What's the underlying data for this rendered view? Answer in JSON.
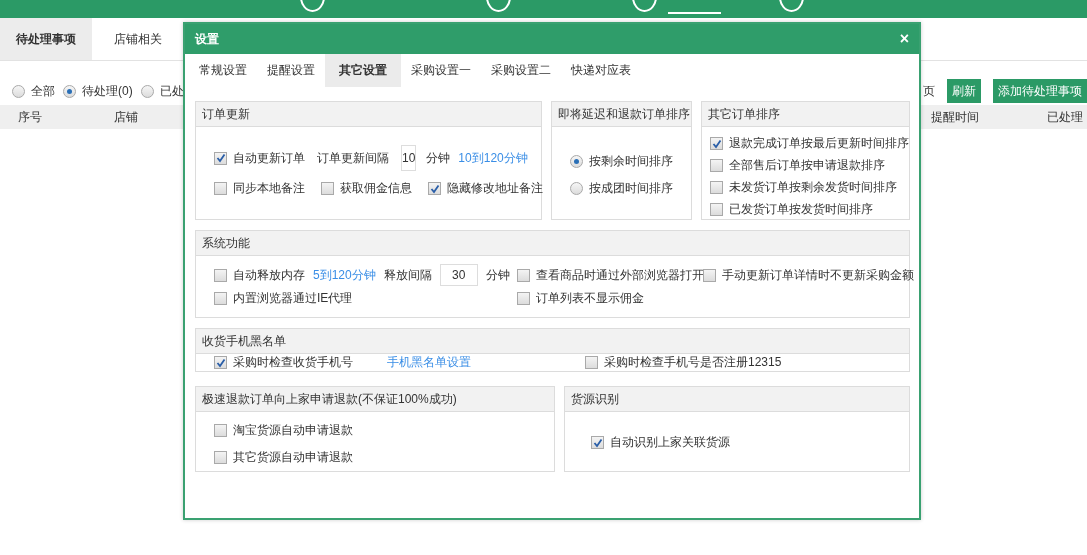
{
  "top_nav": [
    {
      "selected": false
    },
    {
      "selected": false
    },
    {
      "selected": true
    },
    {
      "selected": false
    }
  ],
  "page": {
    "tabs": [
      {
        "label": "待处理事项",
        "selected": true
      },
      {
        "label": "店铺相关",
        "selected": false
      }
    ],
    "filters": [
      {
        "label": "全部",
        "selected": false
      },
      {
        "label": "待处理(0)",
        "selected": true
      },
      {
        "label": "已处",
        "selected": false
      }
    ],
    "pager_fragment": "页",
    "buttons": [
      "刷新",
      "添加待处理事项"
    ],
    "table": {
      "columns": [
        "序号",
        "店铺",
        "提醒时间",
        "已处理"
      ]
    }
  },
  "dialog": {
    "title": "设置",
    "close": "×",
    "tabs": [
      {
        "label": "常规设置",
        "selected": false
      },
      {
        "label": "提醒设置",
        "selected": false
      },
      {
        "label": "其它设置",
        "selected": true
      },
      {
        "label": "采购设置一",
        "selected": false
      },
      {
        "label": "采购设置二",
        "selected": false
      },
      {
        "label": "快递对应表",
        "selected": false
      }
    ],
    "order_update": {
      "title": "订单更新",
      "auto_update": {
        "label": "自动更新订单",
        "checked": true
      },
      "interval_label": "订单更新间隔",
      "interval_value": "10",
      "interval_unit": "分钟",
      "interval_hint": "10到120分钟",
      "options": [
        {
          "label": "同步本地备注",
          "checked": false
        },
        {
          "label": "获取佣金信息",
          "checked": false
        },
        {
          "label": "隐藏修改地址备注",
          "checked": true
        }
      ]
    },
    "deadline_sort": {
      "title": "即将延迟和退款订单排序",
      "options": [
        {
          "label": "按剩余时间排序",
          "selected": true
        },
        {
          "label": "按成团时间排序",
          "selected": false
        }
      ]
    },
    "other_sort": {
      "title": "其它订单排序",
      "options": [
        {
          "label": "退款完成订单按最后更新时间排序",
          "checked": true
        },
        {
          "label": "全部售后订单按申请退款排序",
          "checked": false
        },
        {
          "label": "未发货订单按剩余发货时间排序",
          "checked": false
        },
        {
          "label": "已发货订单按发货时间排序",
          "checked": false
        }
      ]
    },
    "system": {
      "title": "系统功能",
      "auto_release": {
        "label": "自动释放内存",
        "checked": false
      },
      "release_hint": "5到120分钟",
      "release_label": "释放间隔",
      "release_value": "30",
      "release_unit": "分钟",
      "options": [
        {
          "label": "查看商品时通过外部浏览器打开",
          "checked": false
        },
        {
          "label": "手动更新订单详情时不更新采购金额",
          "checked": false
        },
        {
          "label": "内置浏览器通过IE代理",
          "checked": false
        },
        {
          "label": "订单列表不显示佣金",
          "checked": false
        }
      ]
    },
    "phone_blacklist": {
      "title": "收货手机黑名单",
      "check_phone": {
        "label": "采购时检查收货手机号",
        "checked": true
      },
      "settings_link": "手机黑名单设置",
      "check_registered": {
        "label": "采购时检查手机号是否注册12315",
        "checked": false
      }
    },
    "fast_refund": {
      "title": "极速退款订单向上家申请退款(不保证100%成功)",
      "options": [
        {
          "label": "淘宝货源自动申请退款",
          "checked": false
        },
        {
          "label": "其它货源自动申请退款",
          "checked": false
        }
      ]
    },
    "source_detect": {
      "title": "货源识别",
      "options": [
        {
          "label": "自动识别上家关联货源",
          "checked": true
        }
      ]
    }
  }
}
